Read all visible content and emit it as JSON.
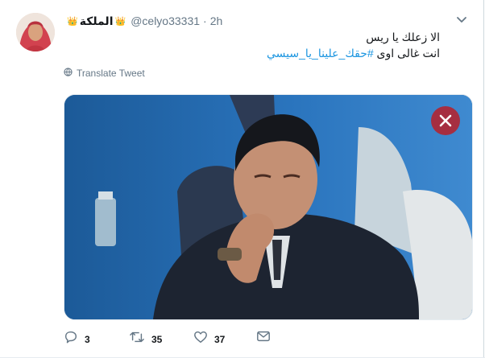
{
  "tweet": {
    "display_name": "الملكة",
    "crowns": [
      "👑",
      "👑"
    ],
    "handle": "@celyo33331",
    "separator": "·",
    "time": "2h",
    "text_line1": "الا زعلك يا ريس",
    "text_line2_prefix": "انت غالى اوى ",
    "hashtag": "#حقك_علينا_يا_سيسي",
    "translate_label": "Translate Tweet",
    "replies": "3",
    "retweets": "35",
    "likes": "37"
  },
  "icons": {
    "avatar": "avatar-photo",
    "chevron": "chevron-down-icon",
    "globe": "globe-icon",
    "close": "close-icon",
    "reply": "reply-icon",
    "retweet": "retweet-icon",
    "like": "heart-icon",
    "dm": "envelope-icon"
  },
  "colors": {
    "link": "#1b95e0",
    "muted": "#657786",
    "close_bg": "#b91e28"
  }
}
